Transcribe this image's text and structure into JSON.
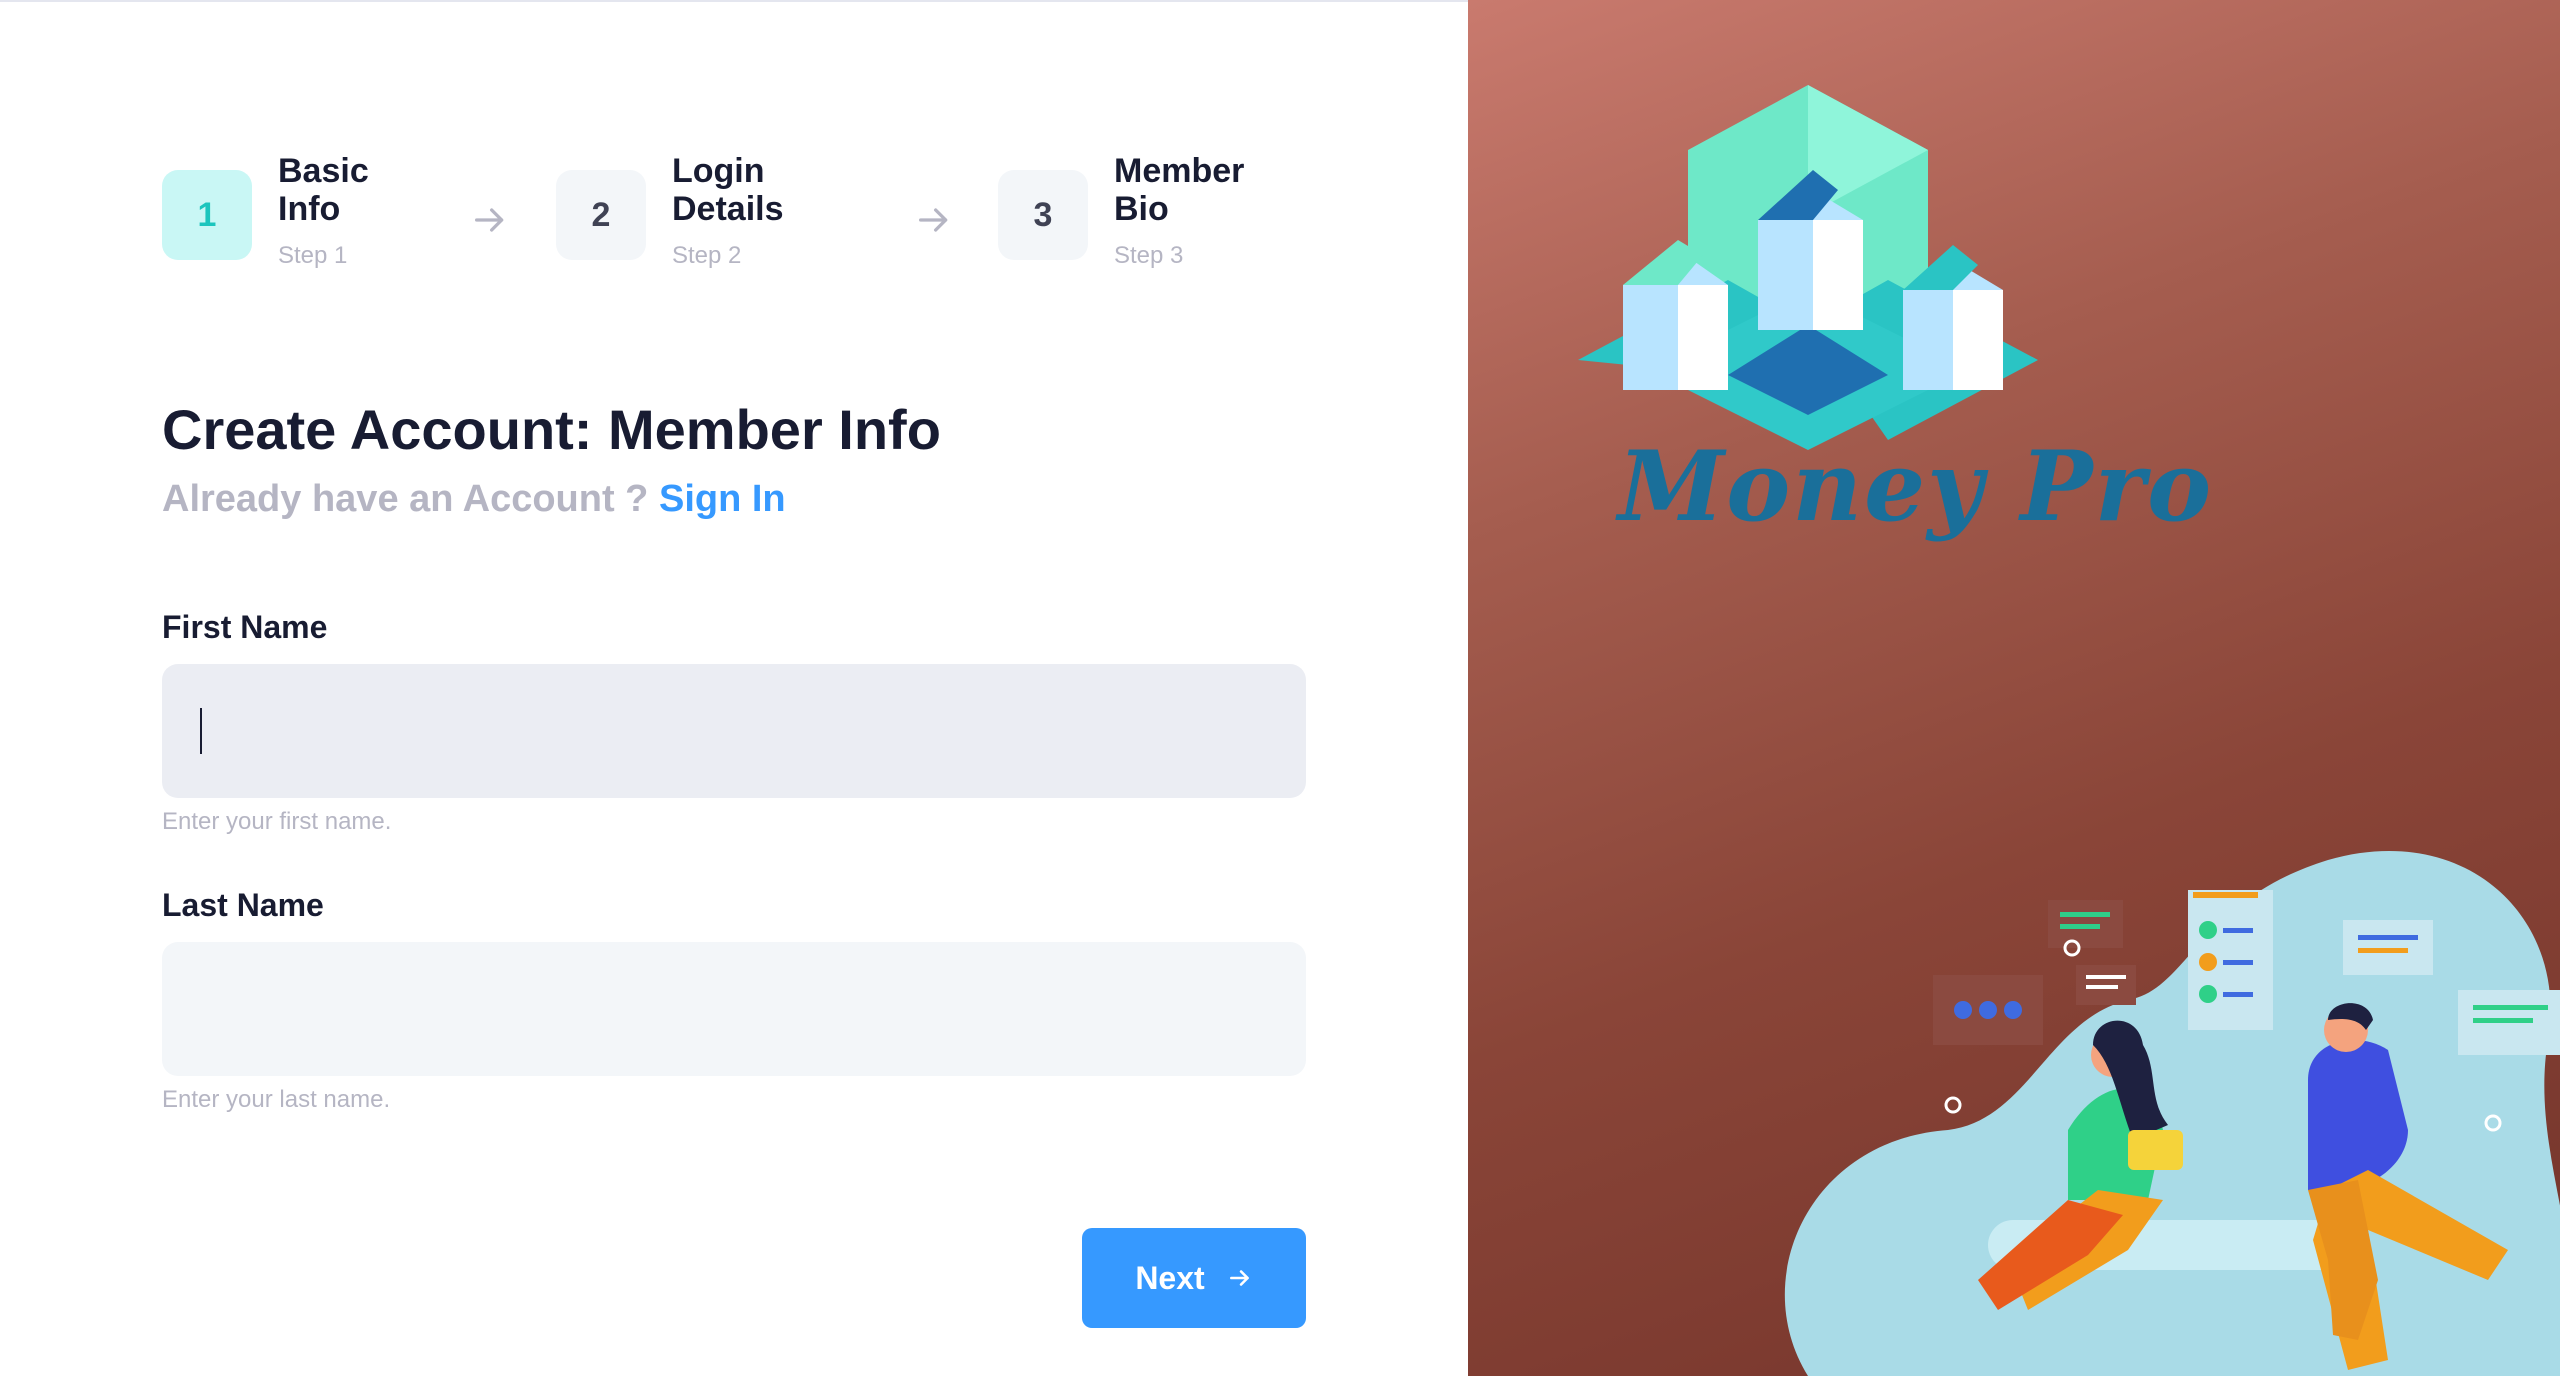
{
  "stepper": {
    "steps": [
      {
        "num": "1",
        "title_line1": "Basic",
        "title_line2": "Info",
        "sub": "Step 1",
        "active": true
      },
      {
        "num": "2",
        "title_line1": "Login",
        "title_line2": "Details",
        "sub": "Step 2",
        "active": false
      },
      {
        "num": "3",
        "title_line1": "Member",
        "title_line2": "Bio",
        "sub": "Step 3",
        "active": false
      }
    ]
  },
  "form": {
    "heading": "Create Account: Member Info",
    "already_text": "Already have an Account ?",
    "sign_in_link": "Sign In",
    "first_name": {
      "label": "First Name",
      "value": "",
      "hint": "Enter your first name."
    },
    "last_name": {
      "label": "Last Name",
      "value": "",
      "hint": "Enter your last name."
    },
    "next_label": "Next"
  },
  "brand": {
    "logo_text": "Money Pro"
  },
  "colors": {
    "accent": "#3699ff",
    "active_step_bg": "#c9f7f5",
    "active_step_fg": "#1bc5bd",
    "logo_teal": "#2ac4c4"
  },
  "icons": {
    "step_arrow": "arrow-right-icon",
    "next_arrow": "chevron-right-icon"
  }
}
